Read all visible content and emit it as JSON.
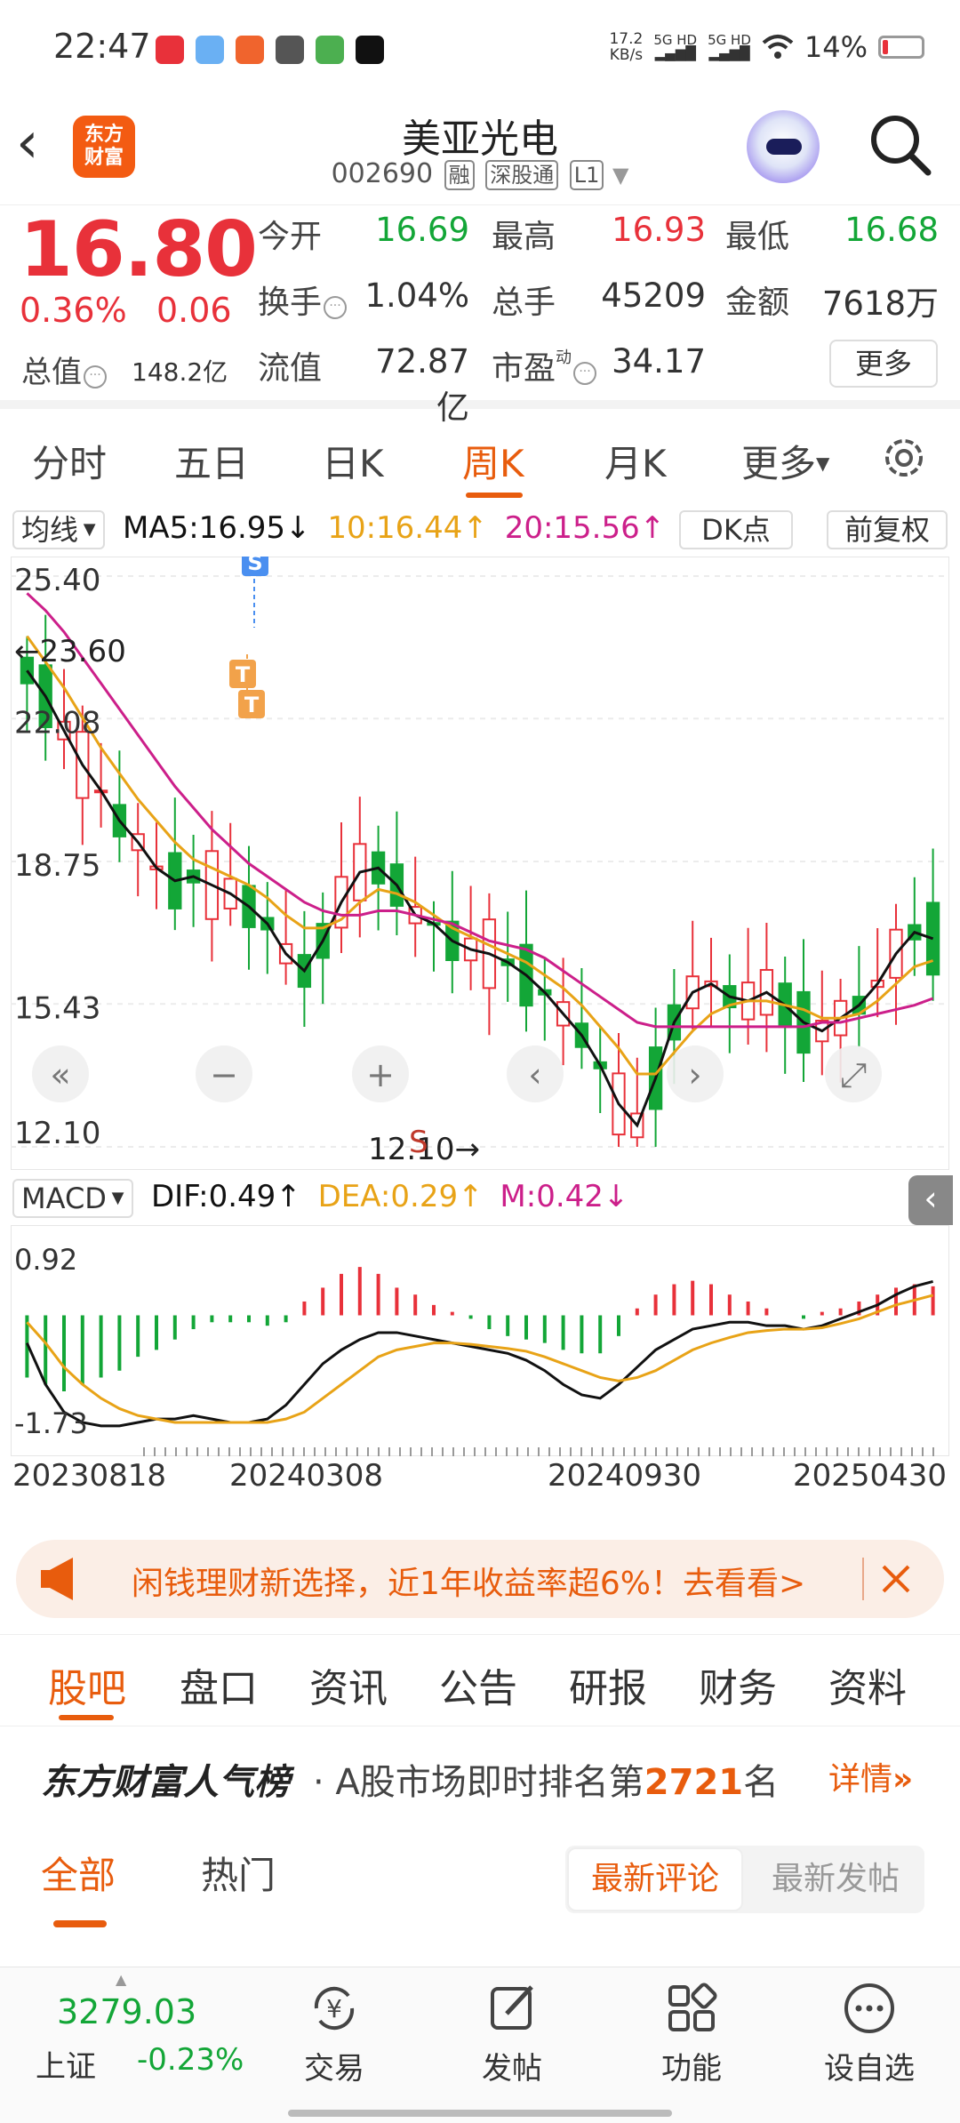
{
  "status": {
    "time": "22:47",
    "net_speed": "17.2",
    "net_unit": "KB/s",
    "sig1": "5G HD",
    "sig2": "5G HD",
    "battery": "14%"
  },
  "header": {
    "stock_name": "美亚光电",
    "stock_code": "002690",
    "tags": [
      "融",
      "深股通",
      "L1"
    ],
    "logo_line1": "东方",
    "logo_line2": "财富"
  },
  "quote": {
    "price": "16.80",
    "pct_change": "0.36%",
    "abs_change": "0.06",
    "mktcap_label": "总值",
    "mktcap_value": "148.2亿",
    "rows": [
      [
        {
          "label": "今开",
          "value": "16.69",
          "color": "#13a637"
        },
        {
          "label": "最高",
          "value": "16.93",
          "color": "#e8313a"
        },
        {
          "label": "最低",
          "value": "16.68",
          "color": "#13a637"
        }
      ],
      [
        {
          "label": "换手",
          "value": "1.04%",
          "color": "#333333"
        },
        {
          "label": "总手",
          "value": "45209",
          "color": "#333333"
        },
        {
          "label": "金额",
          "value": "7618万",
          "color": "#333333"
        }
      ],
      [
        {
          "label": "流值",
          "value": "72.87亿",
          "color": "#333333"
        },
        {
          "label": "市盈",
          "value": "34.17",
          "color": "#333333"
        }
      ]
    ],
    "pe_superscript": "动",
    "more_label": "更多"
  },
  "period_tabs": [
    "分时",
    "五日",
    "日K",
    "周K",
    "月K",
    "更多"
  ],
  "active_period": "周K",
  "ma": {
    "selector": "均线",
    "ma5": "MA5:16.95",
    "ma10": "10:16.44",
    "ma20": "20:15.56",
    "ma5_arrow": "↓",
    "ma10_arrow": "↑",
    "ma20_arrow": "↑",
    "dk_label": "DK点",
    "fq_label": "前复权"
  },
  "colors": {
    "up": "#e8313a",
    "down": "#13a637",
    "ma5": "#111111",
    "ma10": "#e8a317",
    "ma20": "#cc1f8a",
    "accent": "#e85c0d"
  },
  "chart_data": [
    {
      "type": "candlestick",
      "y_ticks": [
        "25.40",
        "22.08",
        "18.75",
        "15.43",
        "12.10"
      ],
      "ylim": [
        12.1,
        25.4
      ],
      "high_marker": "←23.60",
      "low_marker": "12.10→",
      "signals": [
        "S",
        "T",
        "T"
      ],
      "controls_s_label": "S",
      "series": [
        {
          "name": "MA5",
          "values": [
            23.2,
            22.6,
            21.8,
            21.0,
            20.4,
            19.7,
            19.2,
            18.6,
            18.3,
            18.4,
            18.2,
            18.0,
            17.7,
            17.3,
            16.6,
            16.2,
            16.9,
            17.8,
            18.5,
            18.6,
            18.2,
            17.5,
            17.3,
            16.9,
            16.7,
            16.6,
            16.4,
            16.1,
            15.7,
            15.2,
            14.7,
            14.0,
            13.1,
            12.6,
            13.7,
            15.0,
            15.7,
            15.9,
            15.6,
            15.5,
            15.7,
            15.4,
            15.0,
            14.8,
            15.1,
            15.4,
            15.9,
            16.6,
            17.1,
            16.95
          ]
        },
        {
          "name": "MA10",
          "values": [
            24.0,
            23.4,
            22.8,
            22.1,
            21.4,
            20.8,
            20.2,
            19.7,
            19.2,
            18.8,
            18.6,
            18.4,
            18.2,
            17.9,
            17.5,
            17.2,
            17.2,
            17.4,
            17.8,
            18.1,
            18.0,
            17.8,
            17.5,
            17.2,
            17.0,
            16.8,
            16.6,
            16.4,
            16.1,
            15.8,
            15.4,
            14.9,
            14.4,
            13.8,
            13.8,
            14.3,
            14.8,
            15.2,
            15.4,
            15.5,
            15.5,
            15.4,
            15.3,
            15.1,
            15.1,
            15.2,
            15.5,
            15.9,
            16.3,
            16.44
          ]
        },
        {
          "name": "MA20",
          "values": [
            25.0,
            24.6,
            24.1,
            23.5,
            22.9,
            22.3,
            21.7,
            21.1,
            20.5,
            20.0,
            19.5,
            19.1,
            18.7,
            18.4,
            18.1,
            17.8,
            17.6,
            17.5,
            17.5,
            17.6,
            17.6,
            17.5,
            17.4,
            17.3,
            17.1,
            16.9,
            16.8,
            16.7,
            16.5,
            16.2,
            15.9,
            15.6,
            15.3,
            15.0,
            14.9,
            14.9,
            14.9,
            14.9,
            14.9,
            14.9,
            14.9,
            14.9,
            14.9,
            15.0,
            15.0,
            15.1,
            15.2,
            15.3,
            15.4,
            15.56
          ]
        }
      ]
    },
    {
      "type": "bar",
      "name": "MACD",
      "y_ticks": [
        "0.92",
        "-1.73"
      ],
      "ylim": [
        -1.73,
        0.92
      ],
      "dif_label": "DIF:0.49",
      "dea_label": "DEA:0.29",
      "m_label": "M:0.42",
      "dif_arrow": "↑",
      "dea_arrow": "↑",
      "m_arrow": "↓",
      "x_ticks": [
        "20230818",
        "20240308",
        "20240930",
        "20250430"
      ],
      "series": [
        {
          "name": "M",
          "values": [
            -0.9,
            -1.0,
            -1.1,
            -1.0,
            -0.9,
            -0.8,
            -0.6,
            -0.5,
            -0.35,
            -0.2,
            -0.1,
            -0.1,
            -0.1,
            -0.15,
            -0.1,
            0.2,
            0.4,
            0.6,
            0.7,
            0.6,
            0.4,
            0.3,
            0.15,
            0.05,
            -0.05,
            -0.2,
            -0.3,
            -0.35,
            -0.4,
            -0.5,
            -0.55,
            -0.55,
            -0.3,
            0.1,
            0.3,
            0.45,
            0.5,
            0.45,
            0.3,
            0.2,
            0.1,
            0.0,
            -0.05,
            0.05,
            0.1,
            0.2,
            0.3,
            0.4,
            0.45,
            0.42
          ]
        },
        {
          "name": "DIF",
          "values": [
            -0.4,
            -1.0,
            -1.4,
            -1.55,
            -1.6,
            -1.6,
            -1.55,
            -1.5,
            -1.5,
            -1.45,
            -1.5,
            -1.55,
            -1.55,
            -1.5,
            -1.3,
            -1.0,
            -0.7,
            -0.5,
            -0.35,
            -0.25,
            -0.25,
            -0.3,
            -0.35,
            -0.4,
            -0.45,
            -0.5,
            -0.55,
            -0.65,
            -0.8,
            -1.0,
            -1.15,
            -1.2,
            -1.0,
            -0.75,
            -0.5,
            -0.35,
            -0.2,
            -0.15,
            -0.1,
            -0.1,
            -0.15,
            -0.15,
            -0.2,
            -0.15,
            -0.05,
            0.05,
            0.15,
            0.3,
            0.42,
            0.49
          ]
        },
        {
          "name": "DEA",
          "values": [
            -0.1,
            -0.4,
            -0.75,
            -1.0,
            -1.2,
            -1.35,
            -1.45,
            -1.5,
            -1.55,
            -1.55,
            -1.55,
            -1.55,
            -1.55,
            -1.55,
            -1.5,
            -1.4,
            -1.2,
            -1.0,
            -0.8,
            -0.6,
            -0.5,
            -0.45,
            -0.4,
            -0.4,
            -0.42,
            -0.45,
            -0.48,
            -0.52,
            -0.6,
            -0.7,
            -0.8,
            -0.9,
            -0.95,
            -0.9,
            -0.8,
            -0.65,
            -0.5,
            -0.4,
            -0.32,
            -0.25,
            -0.22,
            -0.2,
            -0.2,
            -0.18,
            -0.12,
            -0.05,
            0.05,
            0.15,
            0.22,
            0.29
          ]
        }
      ]
    }
  ],
  "ad": {
    "text": "闲钱理财新选择，近1年收益率超6%！去看看>"
  },
  "section_tabs": [
    "股吧",
    "盘口",
    "资讯",
    "公告",
    "研报",
    "财务",
    "资料"
  ],
  "rank": {
    "title": "东方财富人气榜",
    "prefix": "· A股市场即时排名第",
    "number": "2721",
    "suffix": "名",
    "detail": "详情"
  },
  "feed": {
    "all": "全部",
    "hot": "热门",
    "sort_comment": "最新评论",
    "sort_post": "最新发帖"
  },
  "bottom_nav": {
    "index_value": "3279.03",
    "index_name": "上证",
    "index_change": "-0.23%",
    "items": [
      {
        "label": "交易",
        "icon": "trade-icon"
      },
      {
        "label": "发帖",
        "icon": "post-icon"
      },
      {
        "label": "功能",
        "icon": "grid-icon"
      },
      {
        "label": "设自选",
        "icon": "more-icon"
      }
    ]
  }
}
